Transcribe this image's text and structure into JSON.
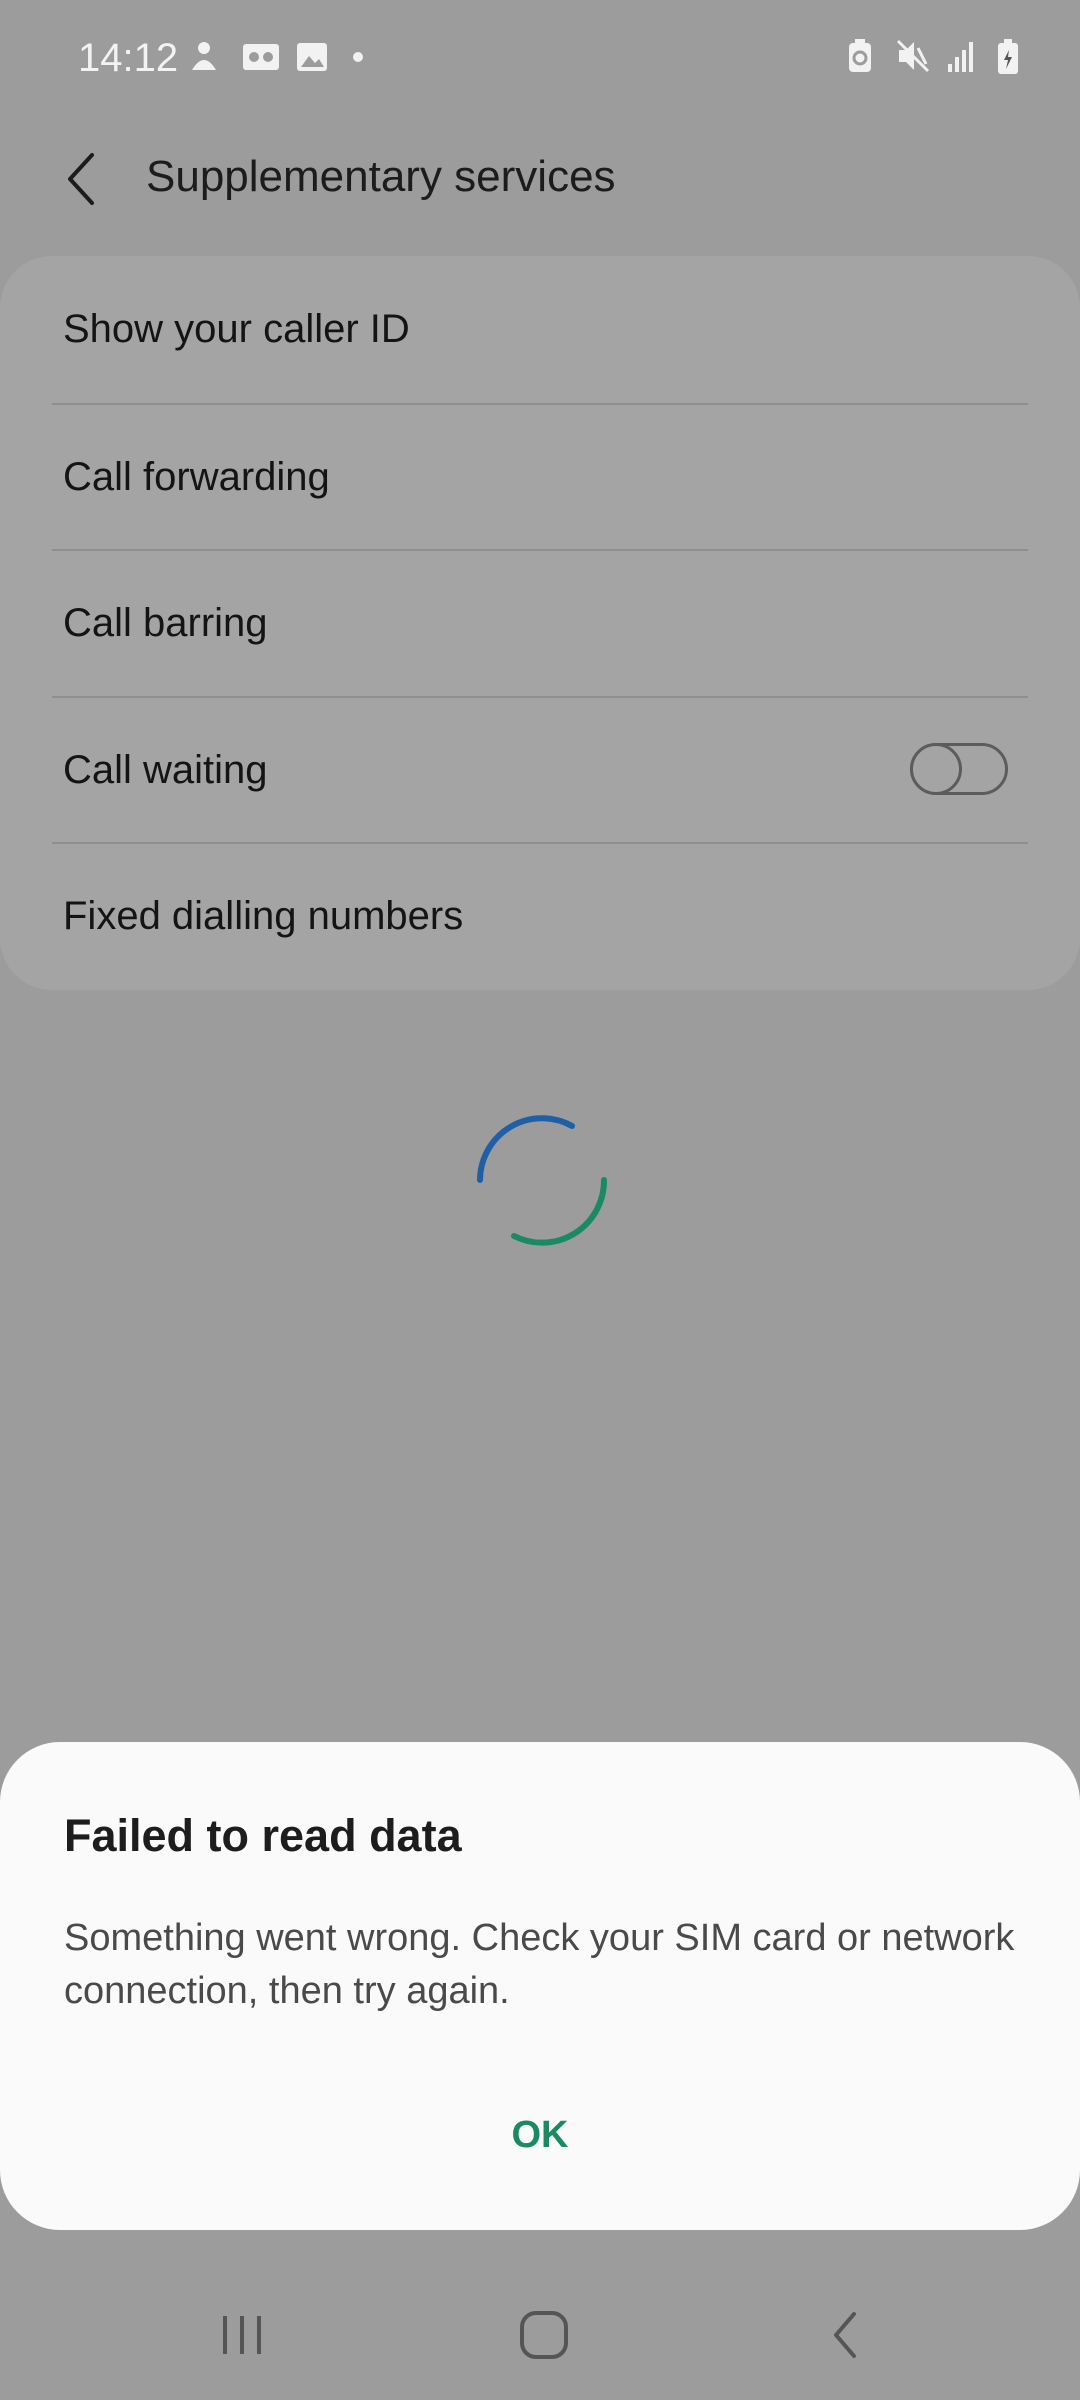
{
  "status_bar": {
    "time": "14:12",
    "left_icons": [
      "notification-person-icon",
      "voicemail-icon",
      "gallery-icon",
      "dot-icon"
    ],
    "right_icons": [
      "battery-saver-icon",
      "mute-icon",
      "signal-icon",
      "battery-icon"
    ]
  },
  "header": {
    "title": "Supplementary services"
  },
  "settings": {
    "items": [
      {
        "label": "Show your caller ID"
      },
      {
        "label": "Call forwarding"
      },
      {
        "label": "Call barring"
      },
      {
        "label": "Call waiting",
        "toggle": false
      },
      {
        "label": "Fixed dialling numbers"
      }
    ]
  },
  "dialog": {
    "title": "Failed to read data",
    "message": "Something went wrong. Check your SIM card or network connection, then try again.",
    "ok_label": "OK"
  },
  "colors": {
    "scrim": "#9c9c9c",
    "accent_green": "#1a8a62",
    "spinner_blue": "#1f5fa8",
    "dialog_bg": "#fafafa"
  }
}
